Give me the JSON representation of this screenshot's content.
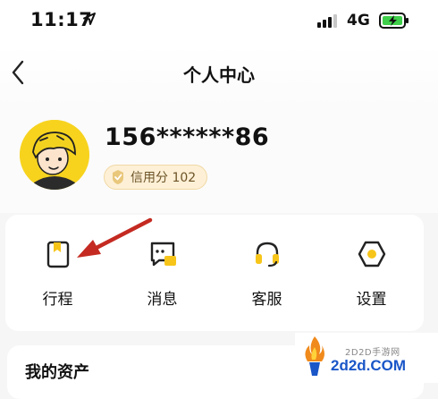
{
  "status_bar": {
    "time": "11:17",
    "network": "4G"
  },
  "header": {
    "title": "个人中心"
  },
  "profile": {
    "phone": "156******86",
    "credit_label": "信用分 102"
  },
  "quick_actions": [
    {
      "label": "行程",
      "icon": "trip-icon"
    },
    {
      "label": "消息",
      "icon": "message-icon"
    },
    {
      "label": "客服",
      "icon": "headset-icon"
    },
    {
      "label": "设置",
      "icon": "settings-icon"
    }
  ],
  "assets": {
    "title": "我的资产"
  },
  "watermark": {
    "site": "2D2D手游网",
    "domain": "2d2d.COM"
  },
  "colors": {
    "accent": "#f7c51a",
    "arrow": "#c42a21",
    "watermark_blue": "#1a56c8"
  }
}
